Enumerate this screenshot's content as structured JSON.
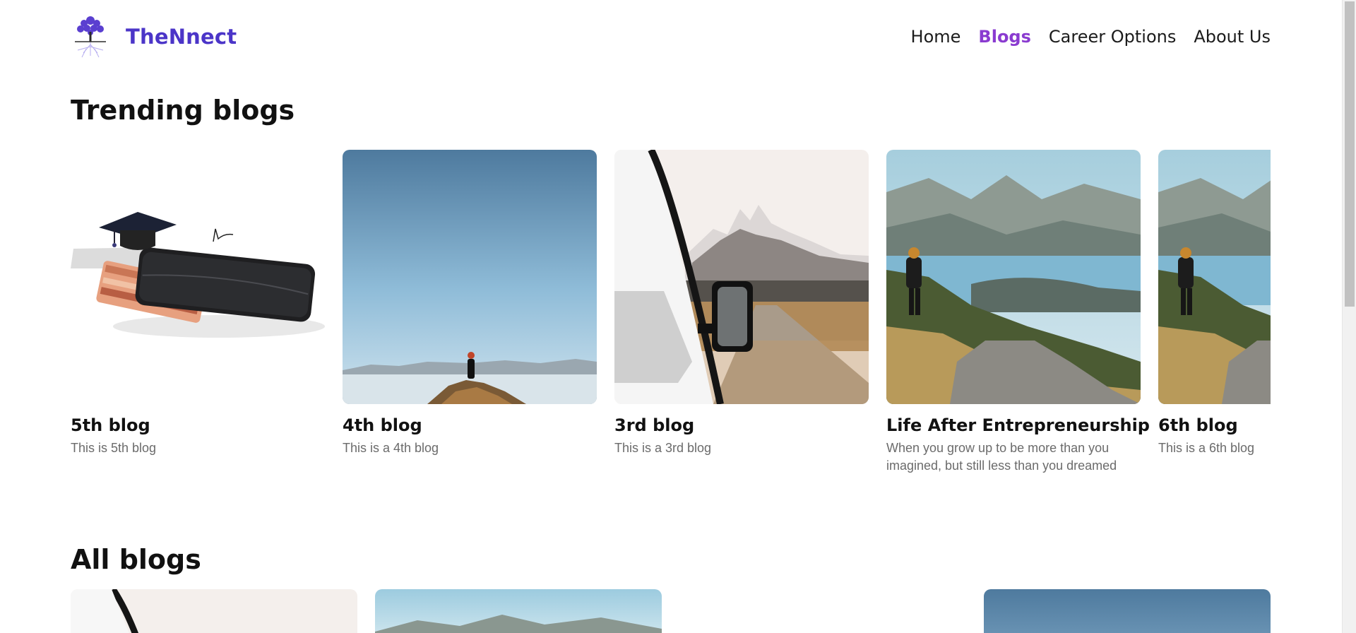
{
  "brand": {
    "name": "TheNnect",
    "logo_icon": "tree-logo-icon"
  },
  "nav": {
    "items": [
      {
        "label": "Home",
        "active": false
      },
      {
        "label": "Blogs",
        "active": true
      },
      {
        "label": "Career Options",
        "active": false
      },
      {
        "label": "About Us",
        "active": false
      }
    ]
  },
  "colors": {
    "brand": "#4b35c8",
    "active_nav": "#8a3bd0",
    "description": "#6b6b6b"
  },
  "trending": {
    "title": "Trending blogs",
    "cards": [
      {
        "title": "5th blog",
        "description": "This is 5th blog",
        "image": "wallet-graduation-cap"
      },
      {
        "title": "4th blog",
        "description": "This is a 4th blog",
        "image": "person-on-mountain-sky"
      },
      {
        "title": "3rd blog",
        "description": "This is a 3rd blog",
        "image": "car-mirror-mountains"
      },
      {
        "title": "Life After Entrepreneurship",
        "description": "When you grow up to be more than you imagined, but still less than you dreamed",
        "image": "hiker-mountain-valley"
      },
      {
        "title": "6th blog",
        "description": "This is a 6th blog",
        "image": "hiker-mountain-valley"
      }
    ]
  },
  "all_blogs": {
    "title": "All blogs"
  }
}
